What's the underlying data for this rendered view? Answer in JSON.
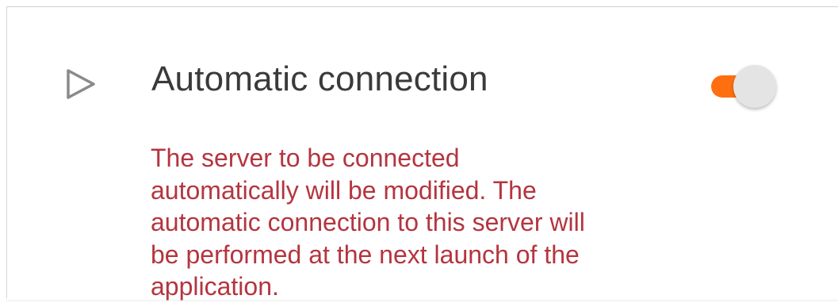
{
  "setting": {
    "title": "Automatic connection",
    "icon": "play-outline-icon",
    "toggle_on": true,
    "warning_lines": [
      "The server to be connected",
      "automatically will be modified. The",
      "automatic connection to this server will",
      "be performed at the next launch of the",
      "application."
    ]
  },
  "colors": {
    "accent": "#ff6f0f",
    "warning_text": "#b4353f",
    "title_text": "#3a3a3a",
    "icon": "#8a8a8a"
  }
}
